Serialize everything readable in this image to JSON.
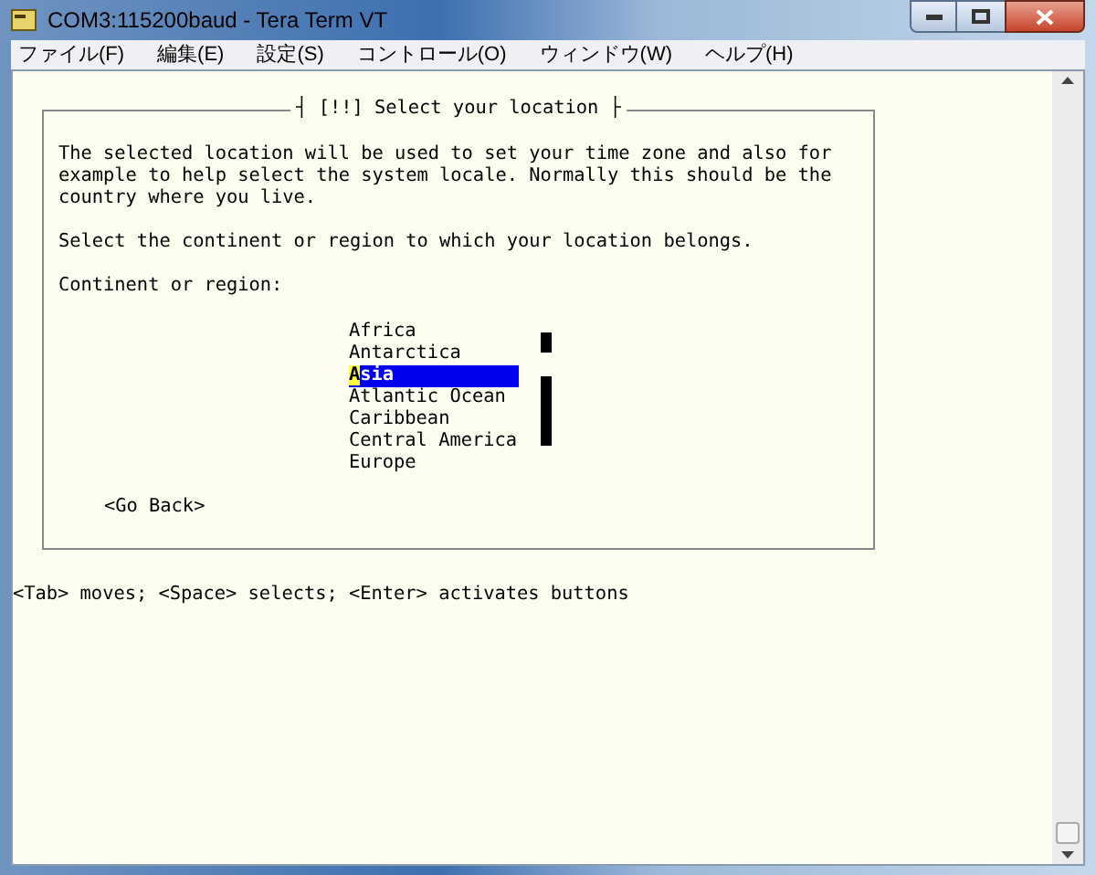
{
  "window": {
    "title": "COM3:115200baud - Tera Term VT"
  },
  "menu": [
    "ファイル(F)",
    "編集(E)",
    "設定(S)",
    "コントロール(O)",
    "ウィンドウ(W)",
    "ヘルプ(H)"
  ],
  "dialog": {
    "title": "┤ [!!] Select your location ├",
    "description": "The selected location will be used to set your time zone and also for example to help select the system locale. Normally this should be the country where you live.",
    "prompt": "Select the continent or region to which your location belongs.",
    "list_label": "Continent or region:",
    "items": [
      {
        "label": "Africa",
        "selected": false
      },
      {
        "label": "Antarctica",
        "selected": false
      },
      {
        "label": "Asia",
        "selected": true
      },
      {
        "label": "Atlantic Ocean",
        "selected": false
      },
      {
        "label": "Caribbean",
        "selected": false
      },
      {
        "label": "Central America",
        "selected": false
      },
      {
        "label": "Europe",
        "selected": false
      }
    ],
    "back_button": "<Go Back>"
  },
  "hint": "<Tab> moves; <Space> selects; <Enter> activates buttons"
}
